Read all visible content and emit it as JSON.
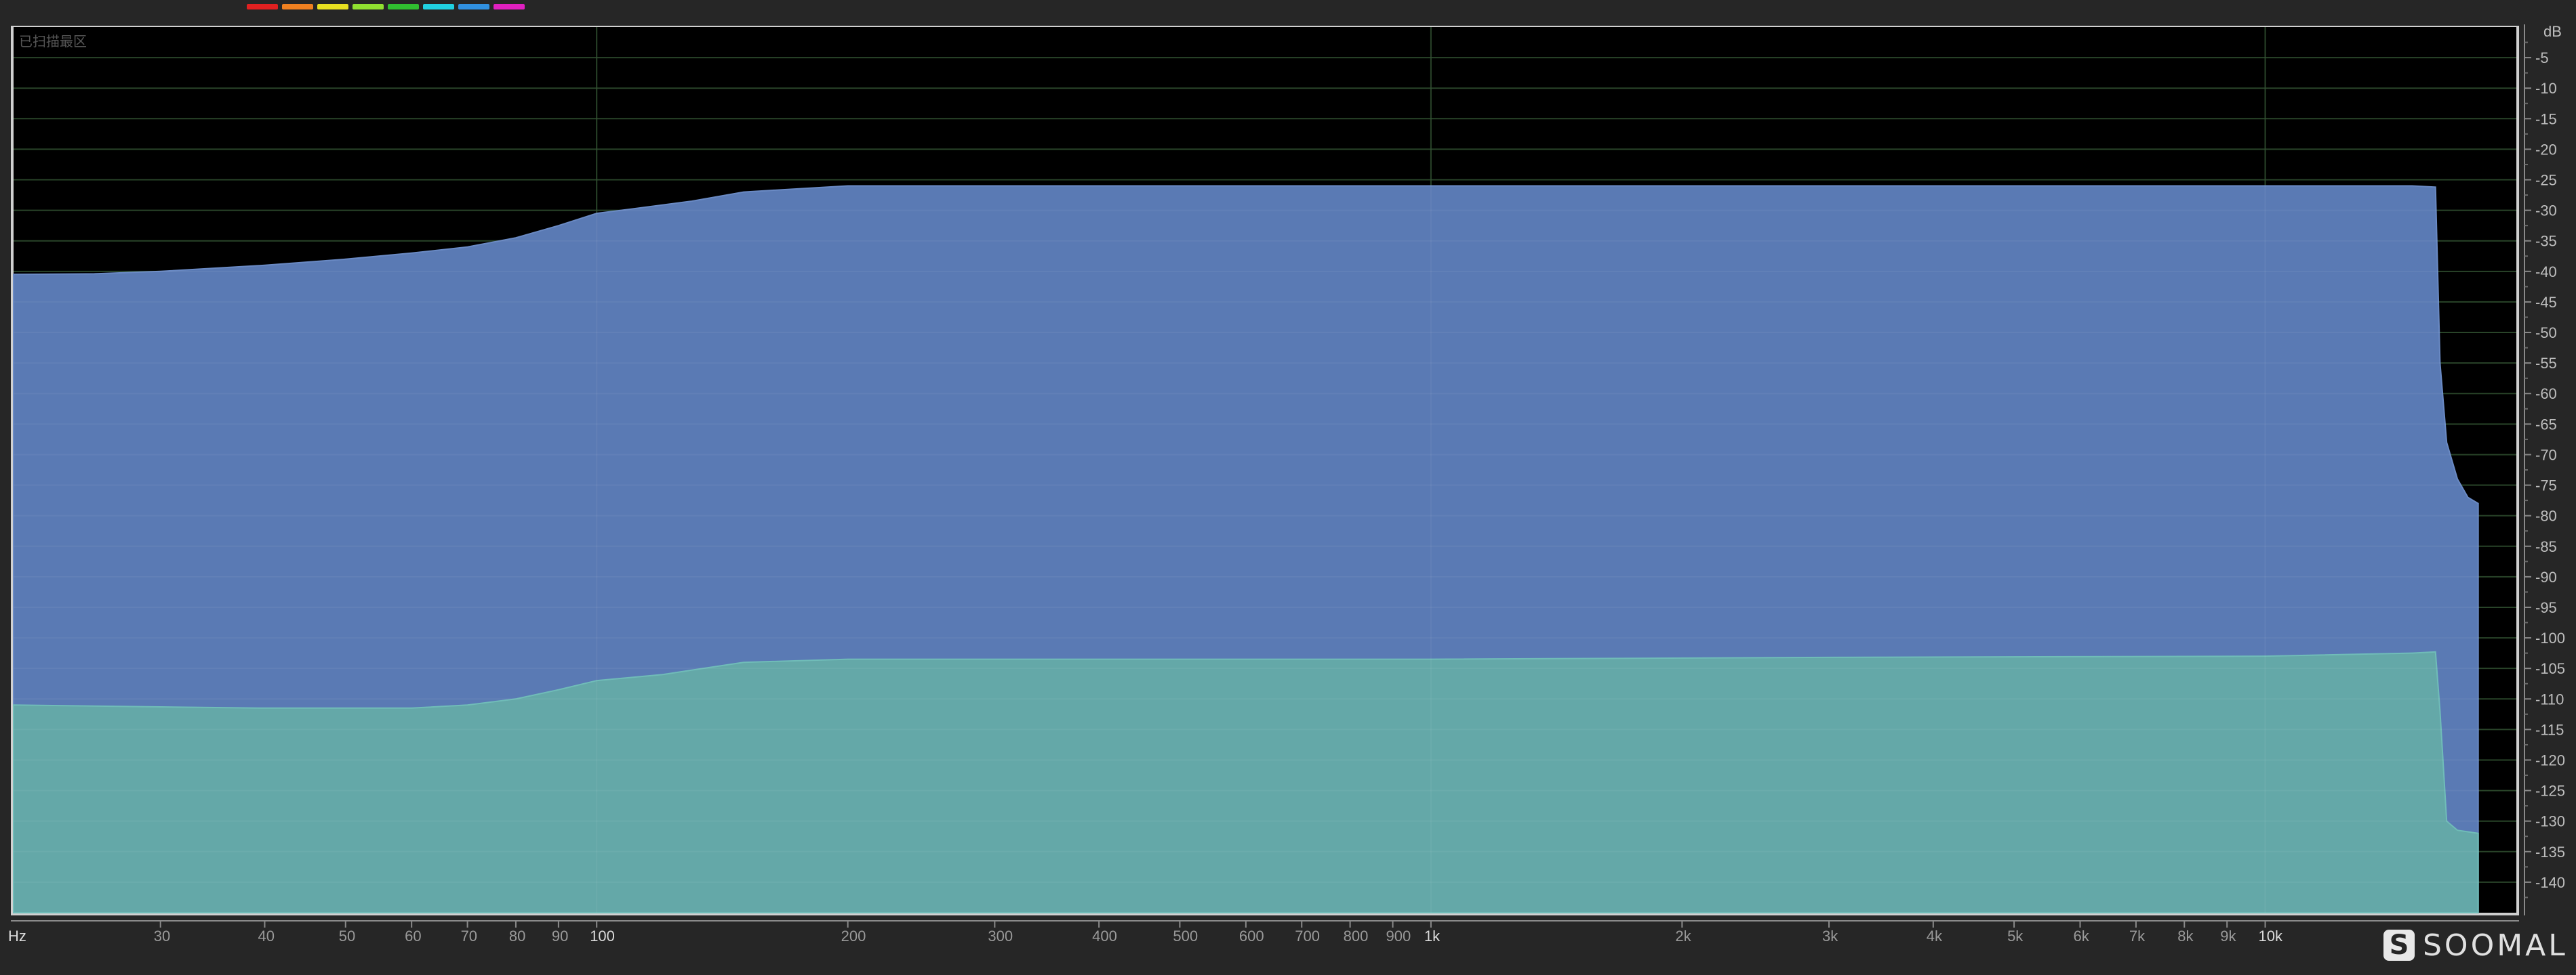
{
  "legend": {
    "colors": [
      "#e02020",
      "#f08020",
      "#e8e020",
      "#90e030",
      "#30c030",
      "#20d0e0",
      "#3090e0",
      "#e020c0"
    ]
  },
  "chart_data": {
    "type": "area",
    "title": "",
    "annotation": "已扫描最区",
    "xlabel": "Hz",
    "ylabel": "dB",
    "x_scale": "log",
    "xlim": [
      20,
      20000
    ],
    "ylim": [
      -145,
      0
    ],
    "grid": true,
    "x_ticks": [
      {
        "v": 30,
        "label": "30"
      },
      {
        "v": 40,
        "label": "40"
      },
      {
        "v": 50,
        "label": "50"
      },
      {
        "v": 60,
        "label": "60"
      },
      {
        "v": 70,
        "label": "70"
      },
      {
        "v": 80,
        "label": "80"
      },
      {
        "v": 90,
        "label": "90"
      },
      {
        "v": 100,
        "label": "100",
        "major": true
      },
      {
        "v": 200,
        "label": "200"
      },
      {
        "v": 300,
        "label": "300"
      },
      {
        "v": 400,
        "label": "400"
      },
      {
        "v": 500,
        "label": "500"
      },
      {
        "v": 600,
        "label": "600"
      },
      {
        "v": 700,
        "label": "700"
      },
      {
        "v": 800,
        "label": "800"
      },
      {
        "v": 900,
        "label": "900"
      },
      {
        "v": 1000,
        "label": "1k",
        "major": true
      },
      {
        "v": 2000,
        "label": "2k"
      },
      {
        "v": 3000,
        "label": "3k"
      },
      {
        "v": 4000,
        "label": "4k"
      },
      {
        "v": 5000,
        "label": "5k"
      },
      {
        "v": 6000,
        "label": "6k"
      },
      {
        "v": 7000,
        "label": "7k"
      },
      {
        "v": 8000,
        "label": "8k"
      },
      {
        "v": 9000,
        "label": "9k"
      },
      {
        "v": 10000,
        "label": "10k",
        "major": true
      }
    ],
    "y_ticks": [
      -5,
      -10,
      -15,
      -20,
      -25,
      -30,
      -35,
      -40,
      -45,
      -50,
      -55,
      -60,
      -65,
      -70,
      -75,
      -80,
      -85,
      -90,
      -95,
      -100,
      -105,
      -110,
      -115,
      -120,
      -125,
      -130,
      -135,
      -140
    ],
    "series": [
      {
        "color": "#5a7ab4",
        "points": [
          [
            20,
            -40.5
          ],
          [
            25,
            -40.4
          ],
          [
            30,
            -40
          ],
          [
            40,
            -39
          ],
          [
            50,
            -38
          ],
          [
            60,
            -37
          ],
          [
            70,
            -36
          ],
          [
            80,
            -34.5
          ],
          [
            90,
            -32.5
          ],
          [
            100,
            -30.5
          ],
          [
            110,
            -29.8
          ],
          [
            130,
            -28.5
          ],
          [
            150,
            -27
          ],
          [
            200,
            -26
          ],
          [
            500,
            -26
          ],
          [
            1000,
            -26
          ],
          [
            5000,
            -26
          ],
          [
            10000,
            -26
          ],
          [
            15000,
            -26
          ],
          [
            16000,
            -26.2
          ],
          [
            16200,
            -55
          ],
          [
            16500,
            -68
          ],
          [
            17000,
            -74
          ],
          [
            17500,
            -77
          ],
          [
            18000,
            -78
          ]
        ]
      },
      {
        "color": "#64a8a8",
        "points": [
          [
            20,
            -111
          ],
          [
            30,
            -111.3
          ],
          [
            40,
            -111.5
          ],
          [
            60,
            -111.5
          ],
          [
            70,
            -111
          ],
          [
            80,
            -110
          ],
          [
            90,
            -108.5
          ],
          [
            100,
            -107
          ],
          [
            120,
            -106
          ],
          [
            150,
            -104
          ],
          [
            200,
            -103.5
          ],
          [
            500,
            -103.5
          ],
          [
            1000,
            -103.5
          ],
          [
            3000,
            -103.2
          ],
          [
            10000,
            -103
          ],
          [
            15000,
            -102.5
          ],
          [
            16000,
            -102.3
          ],
          [
            16200,
            -112
          ],
          [
            16500,
            -130
          ],
          [
            17000,
            -131.5
          ],
          [
            18000,
            -132
          ]
        ]
      }
    ]
  },
  "watermark": {
    "icon": "soomal-logo-icon",
    "glyph": "S",
    "text": "SOOMAL"
  }
}
